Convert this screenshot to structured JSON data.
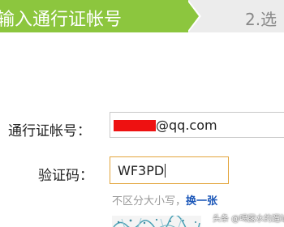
{
  "steps": {
    "step1_label": "输入通行证帐号",
    "step2_label": "2.选"
  },
  "form": {
    "account_label": "通行证帐号：",
    "account_value_suffix": "@qq.com",
    "captcha_label": "验证码：",
    "captcha_value": "WF3PD",
    "hint_text": "不区分大小写，",
    "refresh_link": "换一张"
  },
  "watermark": "头条 @喝露水的遛站",
  "colors": {
    "step_active": "#8cc63e",
    "link": "#1a56b8",
    "input_focus_border": "#e3a53c",
    "redaction": "#ee1111"
  }
}
